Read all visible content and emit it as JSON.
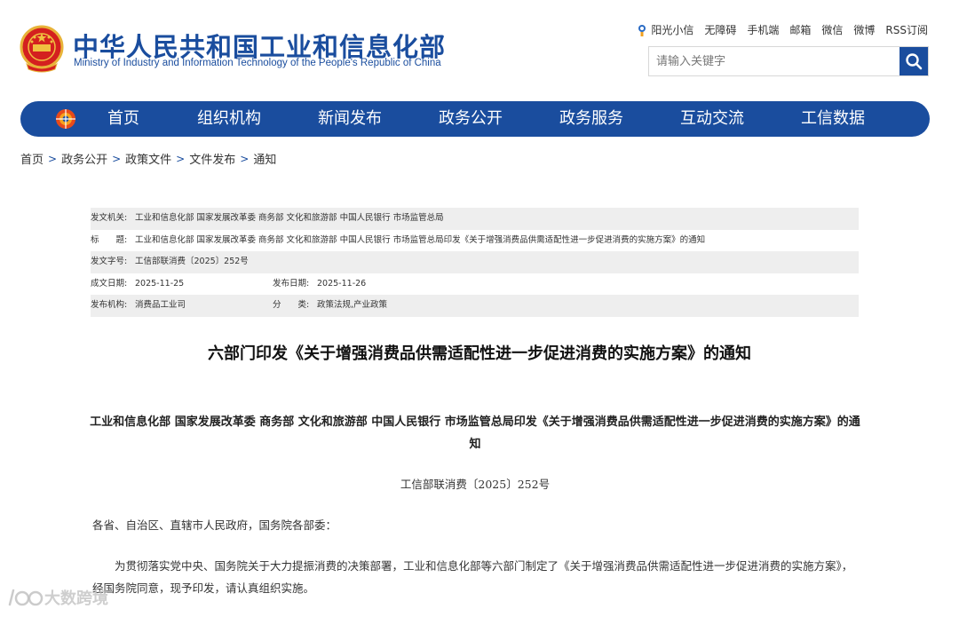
{
  "header": {
    "site_title_cn": "中华人民共和国工业和信息化部",
    "site_title_en": "Ministry of Industry and Information Technology of the People's Republic of China",
    "top_links": [
      "阳光小信",
      "无障碍",
      "手机端",
      "邮箱",
      "微信",
      "微博",
      "RSS订阅"
    ],
    "search_placeholder": "请输入关键字"
  },
  "nav": {
    "items": [
      "首页",
      "组织机构",
      "新闻发布",
      "政务公开",
      "政务服务",
      "互动交流",
      "工信数据"
    ]
  },
  "breadcrumb": [
    "首页",
    "政务公开",
    "政策文件",
    "文件发布",
    "通知"
  ],
  "info": {
    "issuer_label": "发文机关:",
    "issuer": "工业和信息化部 国家发展改革委 商务部 文化和旅游部 中国人民银行 市场监管总局",
    "title_label": "标　　题:",
    "title": "工业和信息化部 国家发展改革委 商务部 文化和旅游部 中国人民银行 市场监管总局印发《关于增强消费品供需适配性进一步促进消费的实施方案》的通知",
    "doc_no_label": "发文字号:",
    "doc_no": "工信部联消费〔2025〕252号",
    "created_label": "成文日期:",
    "created": "2025-11-25",
    "published_label": "发布日期:",
    "published": "2025-11-26",
    "org_label": "发布机构:",
    "org": "消费品工业司",
    "category_label": "分　　类:",
    "category": "政策法规,产业政策"
  },
  "article": {
    "title": "六部门印发《关于增强消费品供需适配性进一步促进消费的实施方案》的通知",
    "heading": "工业和信息化部 国家发展改革委 商务部 文化和旅游部 中国人民银行 市场监管总局印发《关于增强消费品供需适配性进一步促进消费的实施方案》的通知",
    "doc_number": "工信部联消费〔2025〕252号",
    "addressee": "各省、自治区、直辖市人民政府，国务院各部委：",
    "body": "为贯彻落实党中央、国务院关于大力提振消费的决策部署，工业和信息化部等六部门制定了《关于增强消费品供需适配性进一步促进消费的实施方案》，经国务院同意，现予印发，请认真组织实施。"
  },
  "watermark": {
    "text": "大数跨境"
  },
  "colors": {
    "brand_blue": "#1a4d9e",
    "table_shade": "#eeeeee"
  }
}
